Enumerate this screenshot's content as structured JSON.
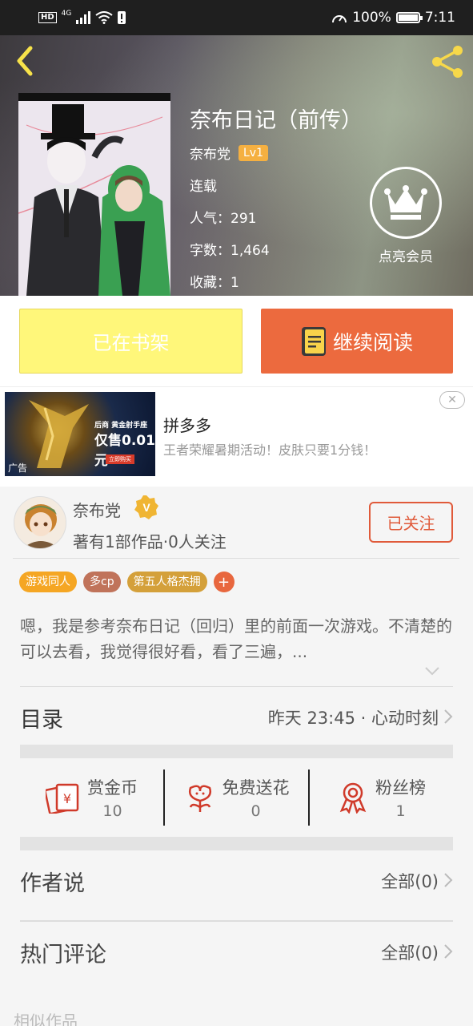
{
  "status_bar": {
    "hd": "HD",
    "network": "4G",
    "battery": "100%",
    "time": "7:11",
    "battery_level": 1.0
  },
  "book": {
    "title": "奈布日记（前传）",
    "author": "奈布党",
    "level": "Lv1",
    "status": "连载",
    "popularity": "人气：291",
    "word_count": "字数：1,464",
    "favorites": "收藏：1",
    "vip_label": "点亮会员"
  },
  "actions": {
    "shelf": "已在书架",
    "read": "继续阅读"
  },
  "ad": {
    "title": "拼多多",
    "description": "王者荣耀暑期活动！皮肤只要1分钱！",
    "image_text1": "后商 黄金射手座",
    "image_text2": "仅售0.01元",
    "image_button": "立即购买",
    "tag": "广告",
    "close": "✕"
  },
  "author": {
    "name": "奈布党",
    "stats": "著有1部作品·0人关注",
    "follow": "已关注"
  },
  "tags": [
    {
      "label": "游戏同人",
      "color": "#f5a623"
    },
    {
      "label": "多cp",
      "color": "#c0735a"
    },
    {
      "label": "第五人格杰拥",
      "color": "#d4a03a"
    }
  ],
  "tag_more": "+",
  "description": "嗯，我是参考奈布日记（回归）里的前面一次游戏。不清楚的可以去看，我觉得很好看，看了三遍，...",
  "toc": {
    "title": "目录",
    "latest": "昨天 23:45 · 心动时刻"
  },
  "stats": [
    {
      "label": "赏金币",
      "value": "10",
      "icon": "reward-coin-icon"
    },
    {
      "label": "免费送花",
      "value": "0",
      "icon": "flower-icon"
    },
    {
      "label": "粉丝榜",
      "value": "1",
      "icon": "medal-icon"
    }
  ],
  "author_says": {
    "title": "作者说",
    "all": "全部(0)"
  },
  "hot_comments": {
    "title": "热门评论",
    "all": "全部(0)"
  },
  "similar": "相似作品",
  "colors": {
    "accent": "#ec6a3e",
    "shelf": "#fff77a",
    "back_arrow": "#f7e24a",
    "share": "#f7d84a"
  }
}
